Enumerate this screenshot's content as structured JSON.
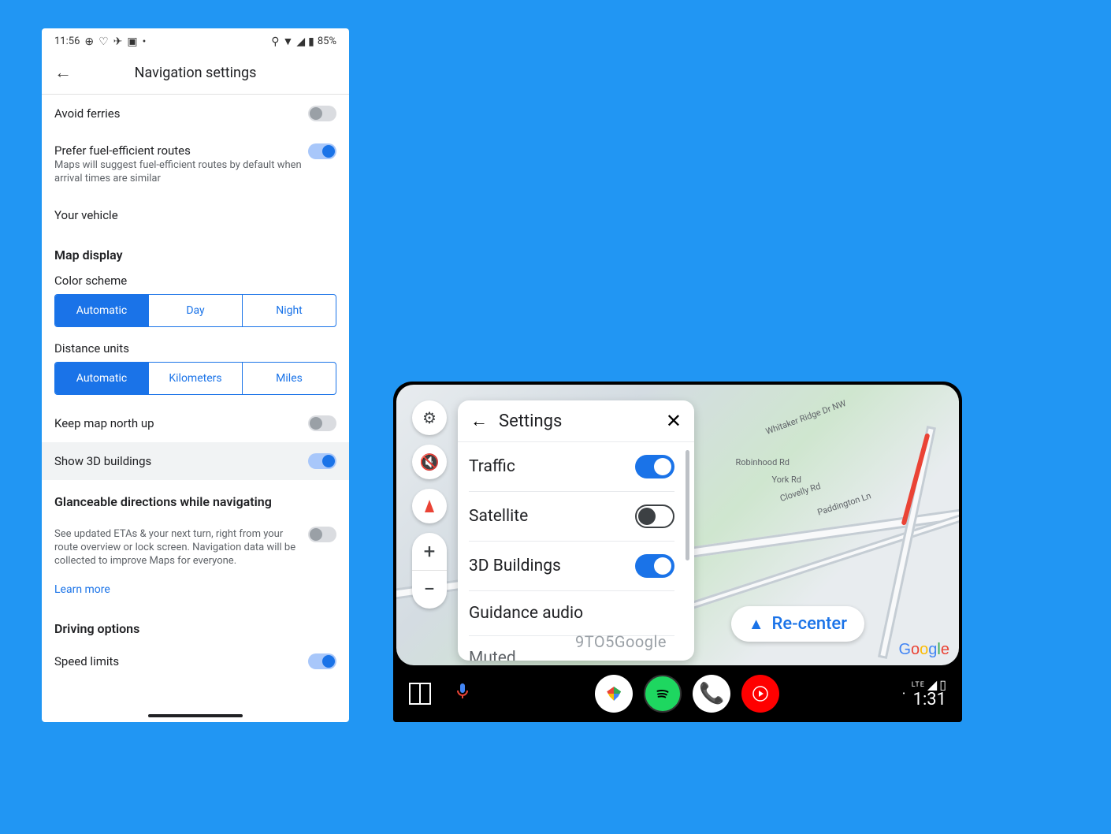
{
  "phone": {
    "status": {
      "time": "11:56",
      "battery": "85%"
    },
    "header": {
      "title": "Navigation settings"
    },
    "items": {
      "avoid_ferries": {
        "label": "Avoid ferries"
      },
      "fuel": {
        "label": "Prefer fuel-efficient routes",
        "sub": "Maps will suggest fuel-efficient routes by default when arrival times are similar"
      },
      "vehicle": {
        "label": "Your vehicle"
      }
    },
    "map_display": {
      "header": "Map display",
      "color_scheme": {
        "label": "Color scheme",
        "options": [
          "Automatic",
          "Day",
          "Night"
        ]
      },
      "distance_units": {
        "label": "Distance units",
        "options": [
          "Automatic",
          "Kilometers",
          "Miles"
        ]
      },
      "north_up": {
        "label": "Keep map north up"
      },
      "show_3d": {
        "label": "Show 3D buildings"
      }
    },
    "glanceable": {
      "header": "Glanceable directions while navigating",
      "desc": "See updated ETAs & your next turn, right from your route overview or lock screen. Navigation data will be collected to improve Maps for everyone.",
      "learn_more": "Learn more"
    },
    "driving": {
      "header": "Driving options",
      "speed_limits": {
        "label": "Speed limits"
      }
    }
  },
  "auto": {
    "panel": {
      "title": "Settings",
      "traffic": "Traffic",
      "satellite": "Satellite",
      "buildings_3d": "3D Buildings",
      "guidance_audio": "Guidance audio",
      "muted": "Muted"
    },
    "roads": {
      "robinhood": "Robinhood Rd",
      "york": "York Rd",
      "clovelly": "Clovelly Rd",
      "whitaker": "Whitaker Ridge Dr NW",
      "paddington": "Paddington Ln"
    },
    "recenter": "Re-center",
    "watermark": "9TO5Google",
    "logo": "Google",
    "bar": {
      "time": "1:31",
      "signal": "LTE"
    }
  }
}
